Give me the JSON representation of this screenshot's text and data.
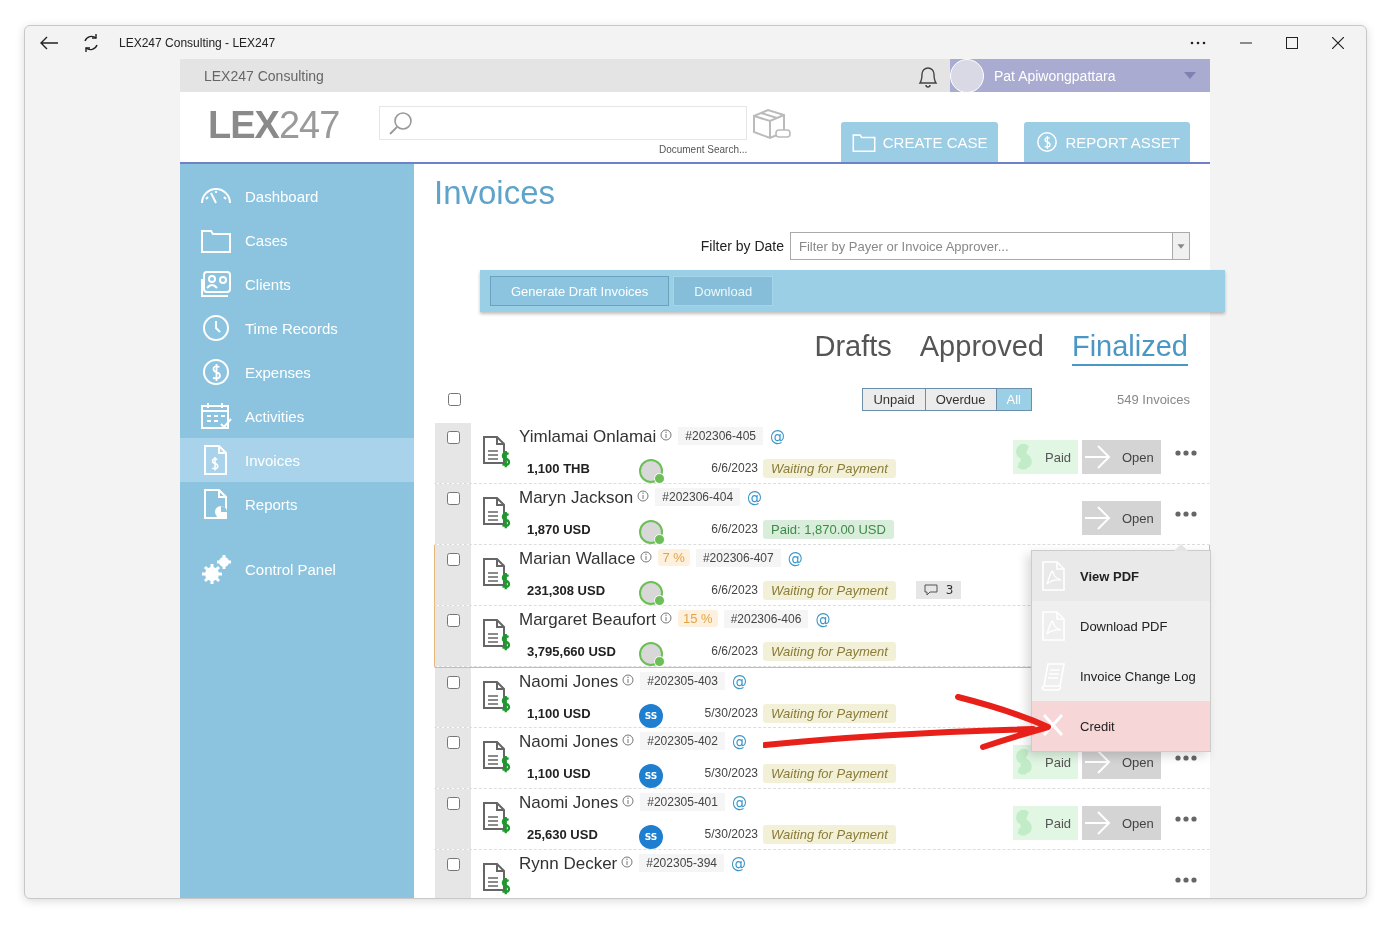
{
  "browser": {
    "title": "LEX247 Consulting - LEX247"
  },
  "topbar": {
    "org": "LEX247 Consulting",
    "user": "Pat Apiwongpattara"
  },
  "header": {
    "logo_bold": "LEX",
    "logo_light": "247",
    "search_caption": "Document Search...",
    "buttons": [
      {
        "label": "CREATE CASE"
      },
      {
        "label": "REPORT ASSET"
      }
    ]
  },
  "sidebar": {
    "groups": [
      {
        "items": [
          {
            "label": "Dashboard",
            "selected": false
          },
          {
            "label": "Cases",
            "selected": false
          },
          {
            "label": "Clients",
            "selected": false
          },
          {
            "label": "Time Records",
            "selected": false
          },
          {
            "label": "Expenses",
            "selected": false
          },
          {
            "label": "Activities",
            "selected": false
          },
          {
            "label": "Invoices",
            "selected": true
          },
          {
            "label": "Reports",
            "selected": false
          }
        ]
      },
      {
        "items": [
          {
            "label": "Control Panel",
            "selected": false
          }
        ]
      }
    ]
  },
  "page": {
    "title": "Invoices",
    "filter_label": "Filter by Date",
    "filter_placeholder": "Filter by Payer or Invoice Approver...",
    "toolbar": [
      {
        "label": "Generate Draft Invoices",
        "disabled": false
      },
      {
        "label": "Download",
        "disabled": true
      }
    ],
    "tabs": [
      {
        "label": "Drafts",
        "selected": false
      },
      {
        "label": "Approved",
        "selected": false
      },
      {
        "label": "Finalized",
        "selected": true
      }
    ],
    "segments": [
      {
        "label": "Unpaid",
        "selected": false
      },
      {
        "label": "Overdue",
        "selected": false
      },
      {
        "label": "All",
        "selected": true
      }
    ],
    "select_all_checked": false,
    "count": "549 Invoices",
    "rows": [
      {
        "name": "Yimlamai Onlamai",
        "id": "#202306-405",
        "email": "@",
        "amount": "1,100 THB",
        "approver": {
          "kind": "photo"
        },
        "date": "6/6/2023",
        "status": {
          "kind": "waiting",
          "text": "Waiting for Payment"
        },
        "paid_button": "Paid",
        "open_button": "Open",
        "more": true,
        "checked": false,
        "highlighted": false
      },
      {
        "name": "Maryn Jackson",
        "id": "#202306-404",
        "email": "@",
        "amount": "1,870 USD",
        "approver": {
          "kind": "photo"
        },
        "date": "6/6/2023",
        "status": {
          "kind": "paid",
          "text": "Paid: 1,870.00 USD"
        },
        "open_button": "Open",
        "more": true,
        "checked": false,
        "highlighted": false
      },
      {
        "name": "Marian Wallace",
        "discount": "7 %",
        "id": "#202306-407",
        "email": "@",
        "amount": "231,308 USD",
        "approver": {
          "kind": "photo"
        },
        "date": "6/6/2023",
        "status": {
          "kind": "waiting",
          "text": "Waiting for Payment"
        },
        "comments": "3",
        "checked": false,
        "highlighted": true
      },
      {
        "name": "Margaret Beaufort",
        "discount": "15 %",
        "id": "#202306-406",
        "email": "@",
        "amount": "3,795,660 USD",
        "approver": {
          "kind": "photo"
        },
        "date": "6/6/2023",
        "status": {
          "kind": "waiting",
          "text": "Waiting for Payment"
        },
        "checked": false,
        "highlighted": true
      },
      {
        "name": "Naomi Jones",
        "id": "#202305-403",
        "email": "@",
        "amount": "1,100 USD",
        "approver": {
          "kind": "initials",
          "initials": "SS"
        },
        "date": "5/30/2023",
        "status": {
          "kind": "waiting",
          "text": "Waiting for Payment"
        },
        "checked": false,
        "highlighted": false
      },
      {
        "name": "Naomi Jones",
        "id": "#202305-402",
        "email": "@",
        "amount": "1,100 USD",
        "approver": {
          "kind": "initials",
          "initials": "SS"
        },
        "date": "5/30/2023",
        "status": {
          "kind": "waiting",
          "text": "Waiting for Payment"
        },
        "paid_button": "Paid",
        "open_button": "Open",
        "more": true,
        "checked": false,
        "highlighted": false
      },
      {
        "name": "Naomi Jones",
        "id": "#202305-401",
        "email": "@",
        "amount": "25,630 USD",
        "approver": {
          "kind": "initials",
          "initials": "SS"
        },
        "date": "5/30/2023",
        "status": {
          "kind": "waiting",
          "text": "Waiting for Payment"
        },
        "paid_button": "Paid",
        "open_button": "Open",
        "more": true,
        "checked": false,
        "highlighted": false
      },
      {
        "name": "Rynn Decker",
        "id": "#202305-394",
        "email": "@",
        "more": true,
        "checked": false,
        "highlighted": false
      }
    ],
    "menu": [
      {
        "label": "View PDF",
        "hovered": true,
        "selected": false
      },
      {
        "label": "Download PDF",
        "hovered": false,
        "selected": false
      },
      {
        "label": "Invoice Change Log",
        "hovered": false,
        "selected": false
      },
      {
        "label": "Credit",
        "hovered": false,
        "selected": true
      }
    ]
  }
}
